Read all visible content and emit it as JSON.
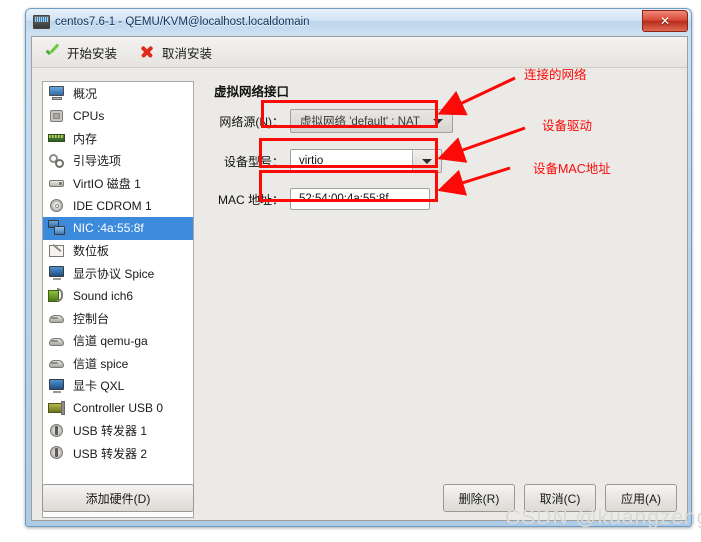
{
  "window": {
    "title": "centos7.6-1 - QEMU/KVM@localhost.localdomain",
    "title_icon": "monitor-icon",
    "close_label": "✕"
  },
  "toolbar": {
    "items": [
      {
        "label": "开始安装",
        "icon": "green-check-icon"
      },
      {
        "label": "取消安装",
        "icon": "red-x-icon"
      }
    ]
  },
  "sidebar": {
    "items": [
      {
        "label": "概况",
        "icon": "monitor-icon",
        "selected": false
      },
      {
        "label": "CPUs",
        "icon": "cpu-chip-icon",
        "selected": false
      },
      {
        "label": "内存",
        "icon": "memory-stick-icon",
        "selected": false
      },
      {
        "label": "引导选项",
        "icon": "gears-icon",
        "selected": false
      },
      {
        "label": "VirtIO 磁盘 1",
        "icon": "hard-disk-icon",
        "selected": false
      },
      {
        "label": "IDE CDROM 1",
        "icon": "cdrom-icon",
        "selected": false
      },
      {
        "label": "NIC :4a:55:8f",
        "icon": "network-card-icon",
        "selected": true
      },
      {
        "label": "数位板",
        "icon": "tablet-icon",
        "selected": false
      },
      {
        "label": "显示协议 Spice",
        "icon": "display-icon",
        "selected": false
      },
      {
        "label": "Sound ich6",
        "icon": "sound-icon",
        "selected": false
      },
      {
        "label": "控制台",
        "icon": "console-icon",
        "selected": false
      },
      {
        "label": "信道 qemu-ga",
        "icon": "channel-icon",
        "selected": false
      },
      {
        "label": "信道 spice",
        "icon": "channel-icon",
        "selected": false
      },
      {
        "label": "显卡 QXL",
        "icon": "video-card-icon",
        "selected": false
      },
      {
        "label": "Controller USB 0",
        "icon": "usb-controller-icon",
        "selected": false
      },
      {
        "label": "USB 转发器 1",
        "icon": "usb-redirector-icon",
        "selected": false
      },
      {
        "label": "USB 转发器 2",
        "icon": "usb-redirector-icon",
        "selected": false
      }
    ],
    "add_hardware_label": "添加硬件(D)"
  },
  "panel": {
    "title": "虚拟网络接口",
    "fields": {
      "network_source": {
        "label": "网络源(N)：",
        "value": "虚拟网络 'default' : NAT"
      },
      "device_model": {
        "label": "设备型号：",
        "value": "virtio"
      },
      "mac_address": {
        "label": "MAC 地址：",
        "value": "52:54:00:4a:55:8f"
      }
    }
  },
  "annotations": [
    {
      "text": "连接的网络"
    },
    {
      "text": "设备驱动"
    },
    {
      "text": "设备MAC地址"
    }
  ],
  "footer": {
    "buttons": [
      {
        "label": "删除(R)"
      },
      {
        "label": "取消(C)"
      },
      {
        "label": "应用(A)"
      }
    ]
  },
  "watermark": "CSDN @kuangzeng",
  "colors": {
    "selection_blue": "#3c8adc",
    "annotation_red": "#fb0a08",
    "panel_bg": "#eceae6"
  }
}
